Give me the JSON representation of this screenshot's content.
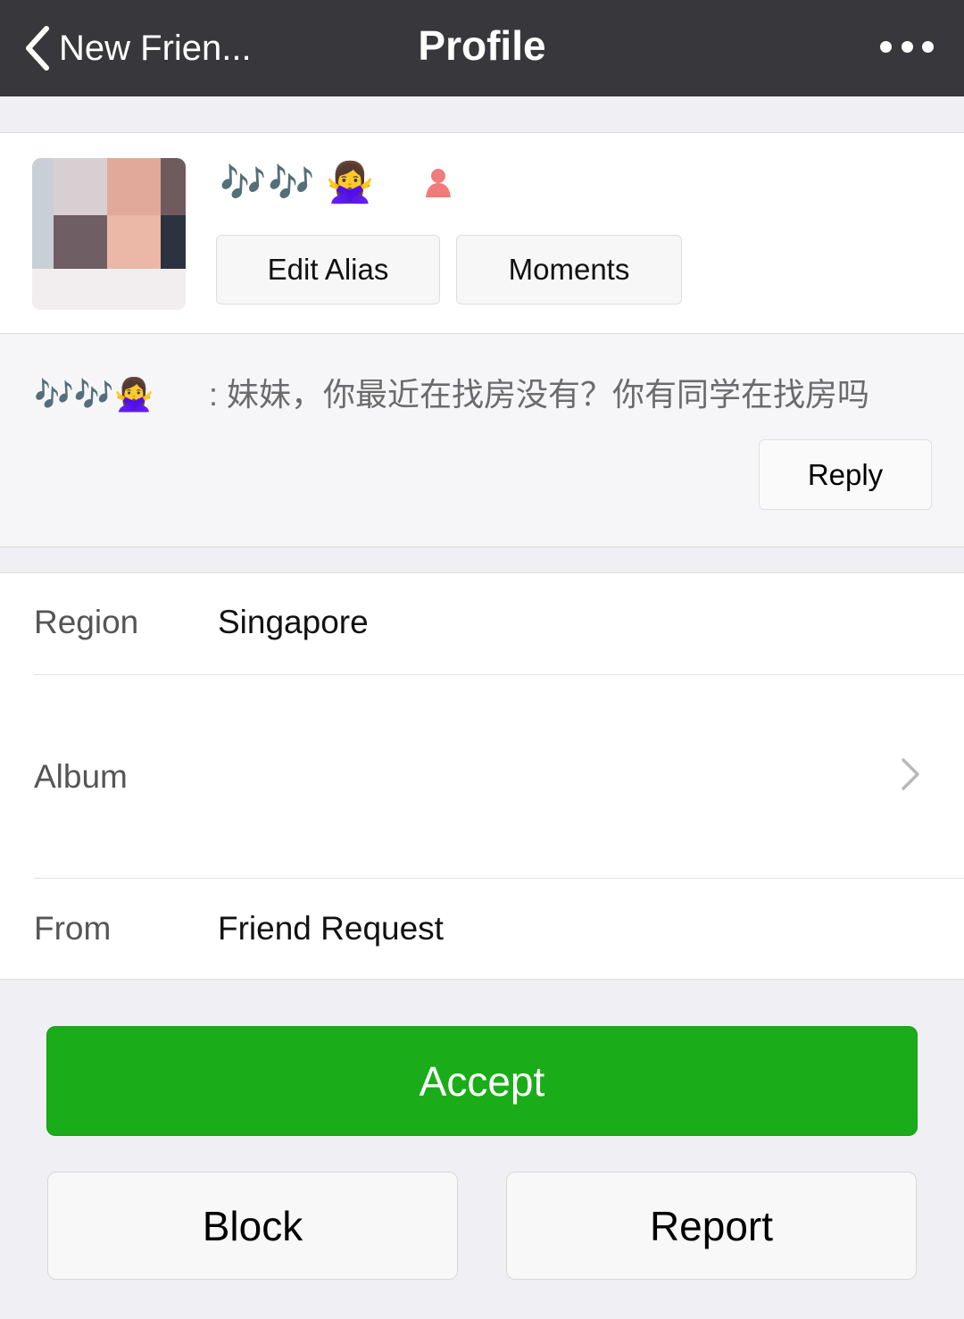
{
  "nav": {
    "back_label": "New Frien...",
    "title": "Profile",
    "more_icon": "more-dots-icon",
    "back_icon": "chevron-left-icon"
  },
  "profile": {
    "nickname": "🎶🎶",
    "nickname_emoji": "🙅‍♀️",
    "gender_icon": "female-person-icon",
    "edit_alias_label": "Edit Alias",
    "moments_label": "Moments"
  },
  "message": {
    "sender": "🎶🎶🙅‍♀️",
    "text": ": 妹妹，你最近在找房没有？你有同学在找房吗",
    "reply_label": "Reply"
  },
  "info": {
    "region_label": "Region",
    "region_value": "Singapore",
    "album_label": "Album",
    "from_label": "From",
    "from_value": "Friend Request"
  },
  "actions": {
    "accept_label": "Accept",
    "block_label": "Block",
    "report_label": "Report"
  },
  "colors": {
    "nav_bg": "#38383c",
    "accept_green": "#1aad19",
    "page_bg": "#efeff4"
  }
}
